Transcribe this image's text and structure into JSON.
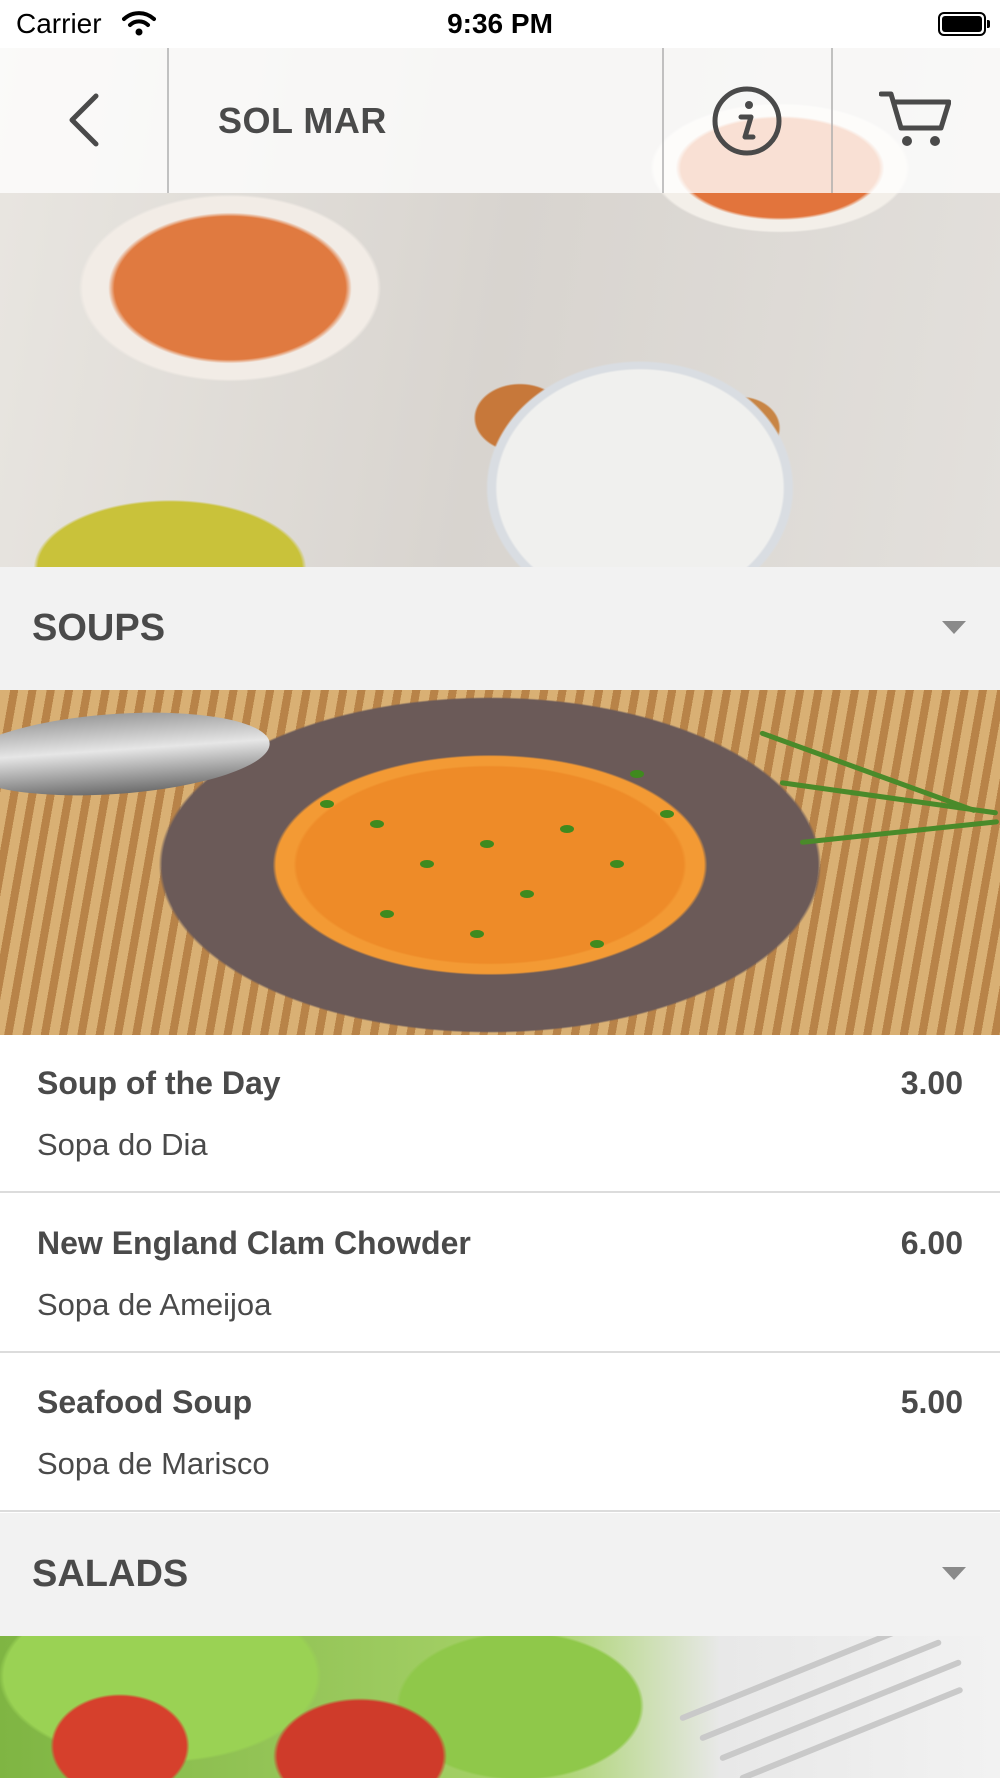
{
  "status_bar": {
    "carrier": "Carrier",
    "time": "9:36 PM"
  },
  "nav": {
    "title": "SOL MAR",
    "icons": [
      "back-chevron-icon",
      "info-icon",
      "cart-icon"
    ]
  },
  "sections": [
    {
      "title": "SOUPS",
      "items": [
        {
          "name": "Soup of the Day",
          "subtitle": "Sopa do Dia",
          "price": "3.00"
        },
        {
          "name": "New England Clam Chowder",
          "subtitle": "Sopa de Ameijoa",
          "price": "6.00"
        },
        {
          "name": "Seafood Soup",
          "subtitle": "Sopa de Marisco",
          "price": "5.00"
        }
      ]
    },
    {
      "title": "SALADS"
    }
  ],
  "colors": {
    "text": "#4a4a4a",
    "section_bg": "#f2f2f2",
    "divider": "#dcdcdc"
  }
}
